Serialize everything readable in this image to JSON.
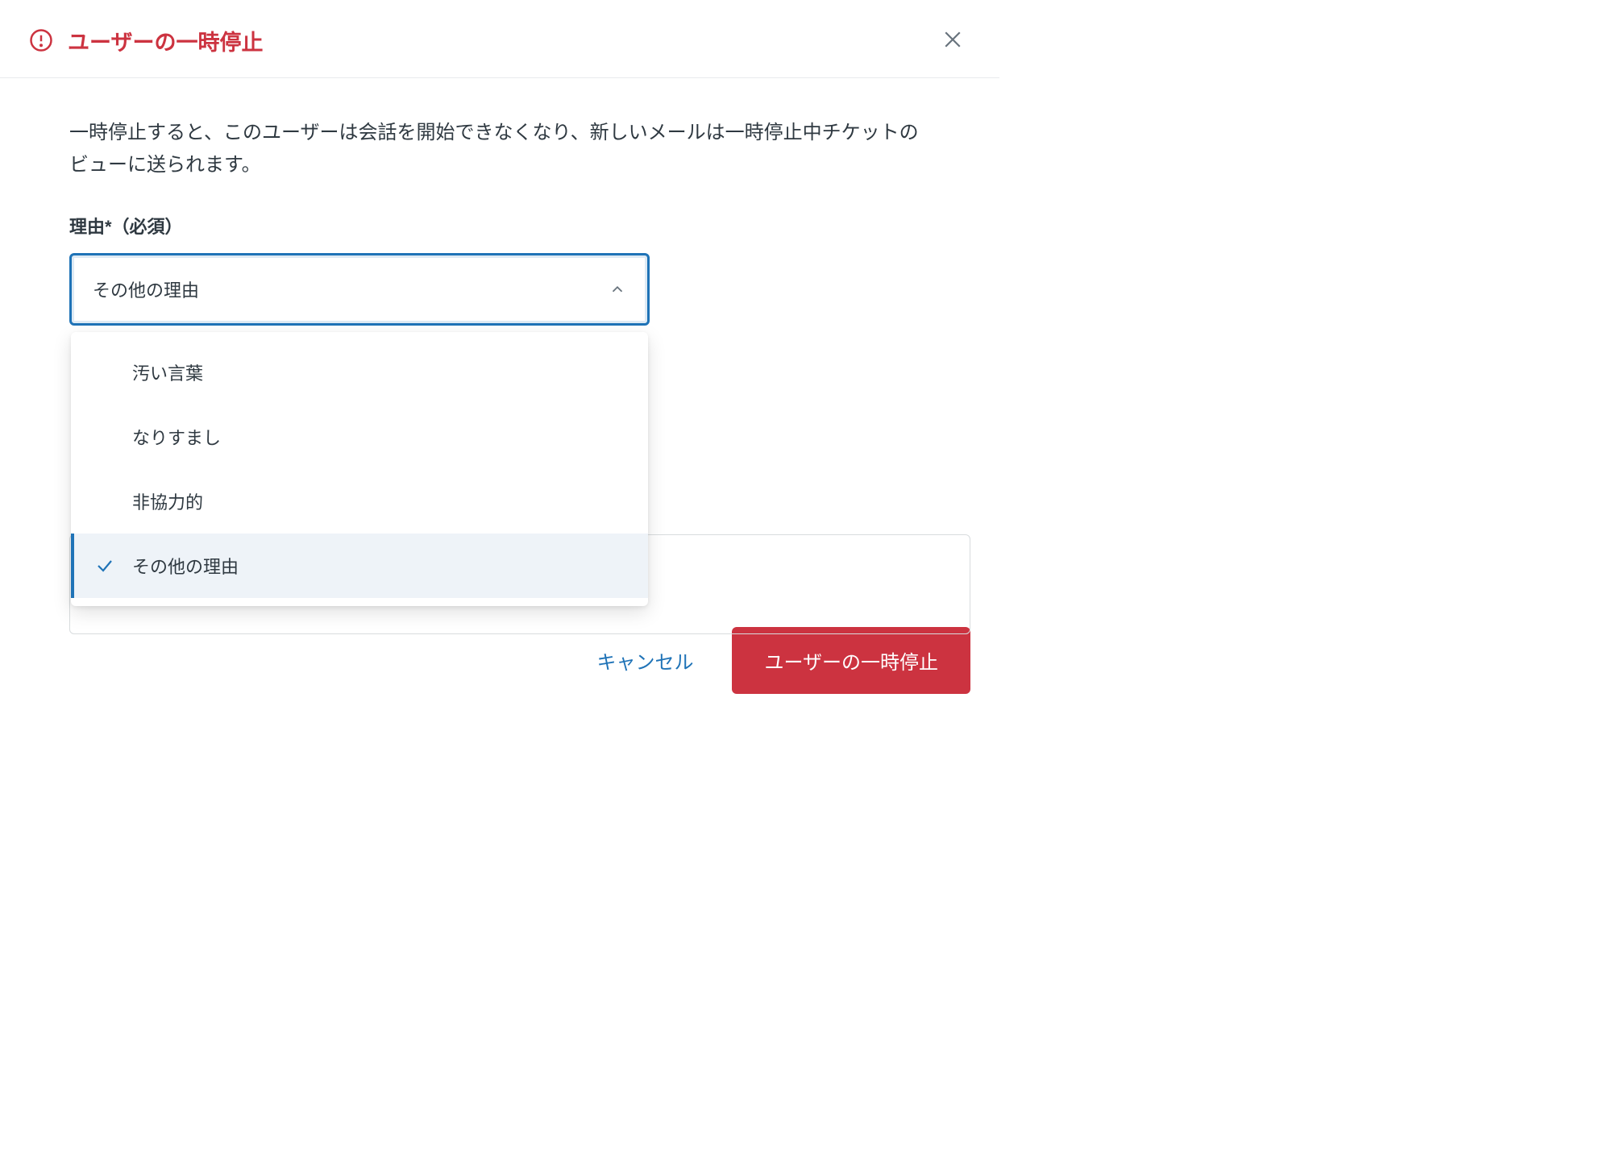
{
  "header": {
    "title": "ユーザーの一時停止"
  },
  "body": {
    "description": "一時停止すると、このユーザーは会話を開始できなくなり、新しいメールは一時停止中チケットのビューに送られます。",
    "reason_label": "理由*（必須）",
    "selected_value": "その他の理由",
    "options": [
      {
        "label": "汚い言葉",
        "selected": false
      },
      {
        "label": "なりすまし",
        "selected": false
      },
      {
        "label": "非協力的",
        "selected": false
      },
      {
        "label": "その他の理由",
        "selected": true
      }
    ]
  },
  "footer": {
    "cancel_label": "キャンセル",
    "submit_label": "ユーザーの一時停止"
  }
}
